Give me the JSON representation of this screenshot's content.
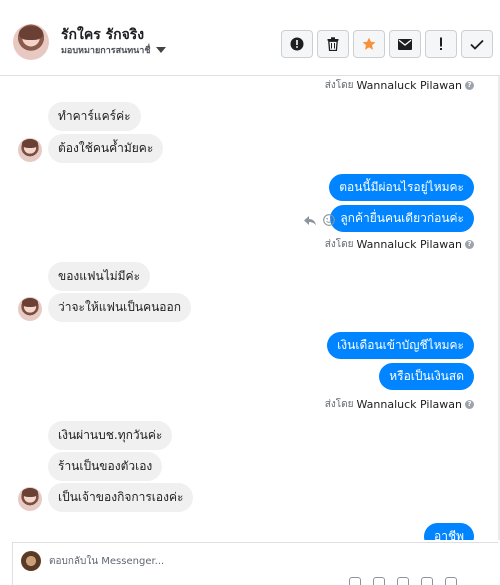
{
  "header": {
    "contact_name": "รักใคร รักจริง",
    "assign_label": "มอบหมายการสนทนาชื่",
    "actions": [
      {
        "icon": "alert-circle-icon",
        "label": "!"
      },
      {
        "icon": "trash-icon",
        "label": ""
      },
      {
        "icon": "star-icon",
        "label": ""
      },
      {
        "icon": "envelope-icon",
        "label": ""
      },
      {
        "icon": "exclamation-icon",
        "label": "!"
      },
      {
        "icon": "checkmark-icon",
        "label": ""
      }
    ]
  },
  "thread": {
    "sender_prefix": "ส่งโดย",
    "sender_name": "Wannaluck Pilawan",
    "help_glyph": "?",
    "groups": [
      {
        "incoming": [
          "ทำคาร์แคร์ค่ะ",
          "ต้องใช้คนค้ำมัยคะ"
        ]
      },
      {
        "outgoing": [
          "ตอนนี้มีผ่อนไรอยู่ไหมคะ",
          "ลูกค้ายื่นคนเดียวก่อนค่ะ"
        ]
      },
      {
        "incoming": [
          "ของแฟนไม่มีค่ะ",
          "ว่าจะให้แฟนเป็นคนออก"
        ]
      },
      {
        "outgoing": [
          "เงินเดือนเข้าบัญชีไหมคะ",
          "หรือเป็นเงินสด"
        ]
      },
      {
        "incoming": [
          "เงินผ่านบช.ทุกวันค่ะ",
          "ร้านเป็นของตัวเอง",
          "เป็นเจ้าของกิจการเองค่ะ"
        ]
      },
      {
        "outgoing": [
          "อาชีพ"
        ]
      }
    ]
  },
  "composer": {
    "placeholder": "ตอบกลับใน Messenger..."
  },
  "colors": {
    "outgoing_bubble": "#0084ff",
    "incoming_bubble": "#f1f0f0",
    "star": "#f7923b"
  }
}
